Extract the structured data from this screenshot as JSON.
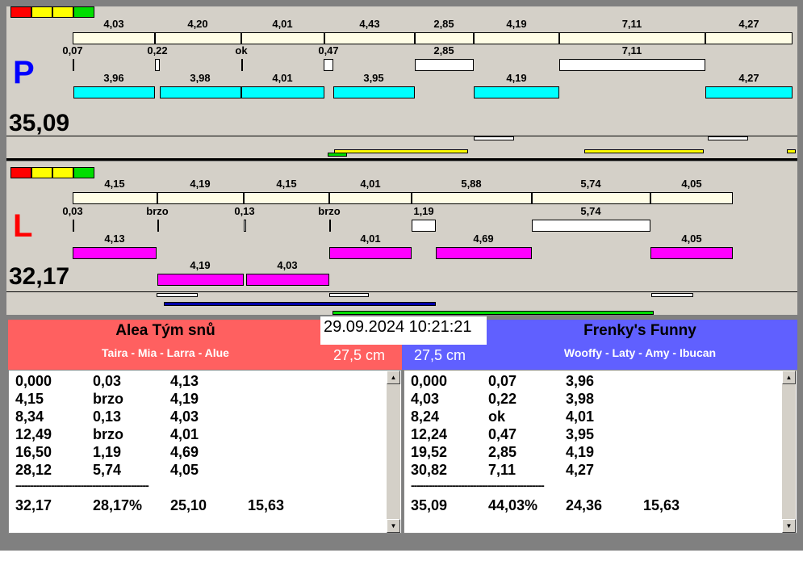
{
  "colors": {
    "red": "#ff0000",
    "yellow": "#ffff00",
    "green": "#00dd00",
    "cream": "#fffde6",
    "cyan": "#00ffff",
    "magenta": "#ff00ff",
    "team_left": "#ff6060",
    "team_right": "#6060ff"
  },
  "panel_p": {
    "side": "P",
    "total": "35,09",
    "row1": [
      "4,03",
      "4,20",
      "4,01",
      "4,43",
      "2,85",
      "4,19",
      "7,11",
      "4,27"
    ],
    "row2": [
      "0,07",
      "0,22",
      "ok",
      "0,47",
      "2,85",
      "7,11"
    ],
    "row3": [
      "3,96",
      "3,98",
      "4,01",
      "3,95",
      "4,19",
      "4,27"
    ]
  },
  "panel_l": {
    "side": "L",
    "total": "32,17",
    "row1": [
      "4,15",
      "4,19",
      "4,15",
      "4,01",
      "5,88",
      "5,74",
      "4,05"
    ],
    "row2": [
      "0,03",
      "brzo",
      "0,13",
      "brzo",
      "1,19",
      "5,74"
    ],
    "row3": [
      "4,13",
      "4,01",
      "4,69",
      "4,05"
    ],
    "row4": [
      "4,19",
      "4,03"
    ]
  },
  "datetime": "29.09.2024 10:21:21",
  "left_team": {
    "name": "Alea Tým snů",
    "members": "Taira - Mia - Larra - Alue",
    "height": "27,5 cm",
    "rows": [
      [
        "0,000",
        "0,03",
        "4,13"
      ],
      [
        "4,15",
        "brzo",
        "4,19"
      ],
      [
        "8,34",
        "0,13",
        "4,03"
      ],
      [
        "12,49",
        "brzo",
        "4,01"
      ],
      [
        "16,50",
        "1,19",
        "4,69"
      ],
      [
        "28,12",
        "5,74",
        "4,05"
      ]
    ],
    "separator": "---------------------------------------------",
    "summary": [
      "32,17",
      "28,17%",
      "25,10",
      "15,63"
    ]
  },
  "right_team": {
    "name": "Frenky's Funny",
    "members": "Wooffy - Laty - Amy - Ibucan",
    "height": "27,5 cm",
    "rows": [
      [
        "0,000",
        "0,07",
        "3,96"
      ],
      [
        "4,03",
        "0,22",
        "3,98"
      ],
      [
        "8,24",
        "ok",
        "4,01"
      ],
      [
        "12,24",
        "0,47",
        "3,95"
      ],
      [
        "19,52",
        "2,85",
        "4,19"
      ],
      [
        "30,82",
        "7,11",
        "4,27"
      ]
    ],
    "separator": "---------------------------------------------",
    "summary": [
      "35,09",
      "44,03%",
      "24,36",
      "15,63"
    ]
  }
}
